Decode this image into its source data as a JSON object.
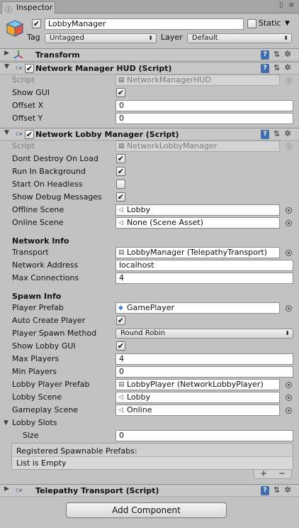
{
  "window": {
    "tab_title": "Inspector",
    "tab_icon": "info-icon",
    "lock_icon": "lock-icon",
    "menu_icon": "menu-icon"
  },
  "gameobject": {
    "active_checked": "✔",
    "name": "LobbyManager",
    "static_label": "Static",
    "static_checked": "",
    "tag_label": "Tag",
    "tag_value": "Untagged",
    "layer_label": "Layer",
    "layer_value": "Default"
  },
  "components": {
    "transform": {
      "title": "Transform"
    },
    "hud": {
      "title": "Network Manager HUD (Script)",
      "script_label": "Script",
      "script_value": "NetworkManagerHUD",
      "show_gui_label": "Show GUI",
      "offset_x_label": "Offset X",
      "offset_x_value": "0",
      "offset_y_label": "Offset Y",
      "offset_y_value": "0"
    },
    "lobby": {
      "title": "Network Lobby Manager (Script)",
      "script_label": "Script",
      "script_value": "NetworkLobbyManager",
      "dont_destroy_label": "Dont Destroy On Load",
      "run_background_label": "Run In Background",
      "start_headless_label": "Start On Headless",
      "show_debug_label": "Show Debug Messages",
      "offline_scene_label": "Offline Scene",
      "offline_scene_value": "Lobby",
      "online_scene_label": "Online Scene",
      "online_scene_value": "None (Scene Asset)",
      "network_info_header": "Network Info",
      "transport_label": "Transport",
      "transport_value": "LobbyManager (TelepathyTransport)",
      "network_address_label": "Network Address",
      "network_address_value": "localhost",
      "max_connections_label": "Max Connections",
      "max_connections_value": "4",
      "spawn_info_header": "Spawn Info",
      "player_prefab_label": "Player Prefab",
      "player_prefab_value": "GamePlayer",
      "auto_create_label": "Auto Create Player",
      "spawn_method_label": "Player Spawn Method",
      "spawn_method_value": "Round Robin",
      "show_lobby_gui_label": "Show Lobby GUI",
      "max_players_label": "Max Players",
      "max_players_value": "4",
      "min_players_label": "Min Players",
      "min_players_value": "0",
      "lobby_player_prefab_label": "Lobby Player Prefab",
      "lobby_player_prefab_value": "LobbyPlayer (NetworkLobbyPlayer)",
      "lobby_scene_label": "Lobby Scene",
      "lobby_scene_value": "Lobby",
      "gameplay_scene_label": "Gameplay Scene",
      "gameplay_scene_value": "Online",
      "lobby_slots_label": "Lobby Slots",
      "size_label": "Size",
      "size_value": "0",
      "registered_prefabs_header": "Registered Spawnable Prefabs:",
      "list_empty_text": "List is Empty",
      "list_add": "+",
      "list_remove": "−"
    },
    "telepathy": {
      "title": "Telepathy Transport (Script)"
    }
  },
  "checks": {
    "on": "✔",
    "off": ""
  },
  "header_icons": {
    "help_glyph": "?",
    "presets_glyph": "⇅",
    "gear_glyph": "✲",
    "script_glyph": "C#"
  },
  "add_component_label": "Add Component"
}
